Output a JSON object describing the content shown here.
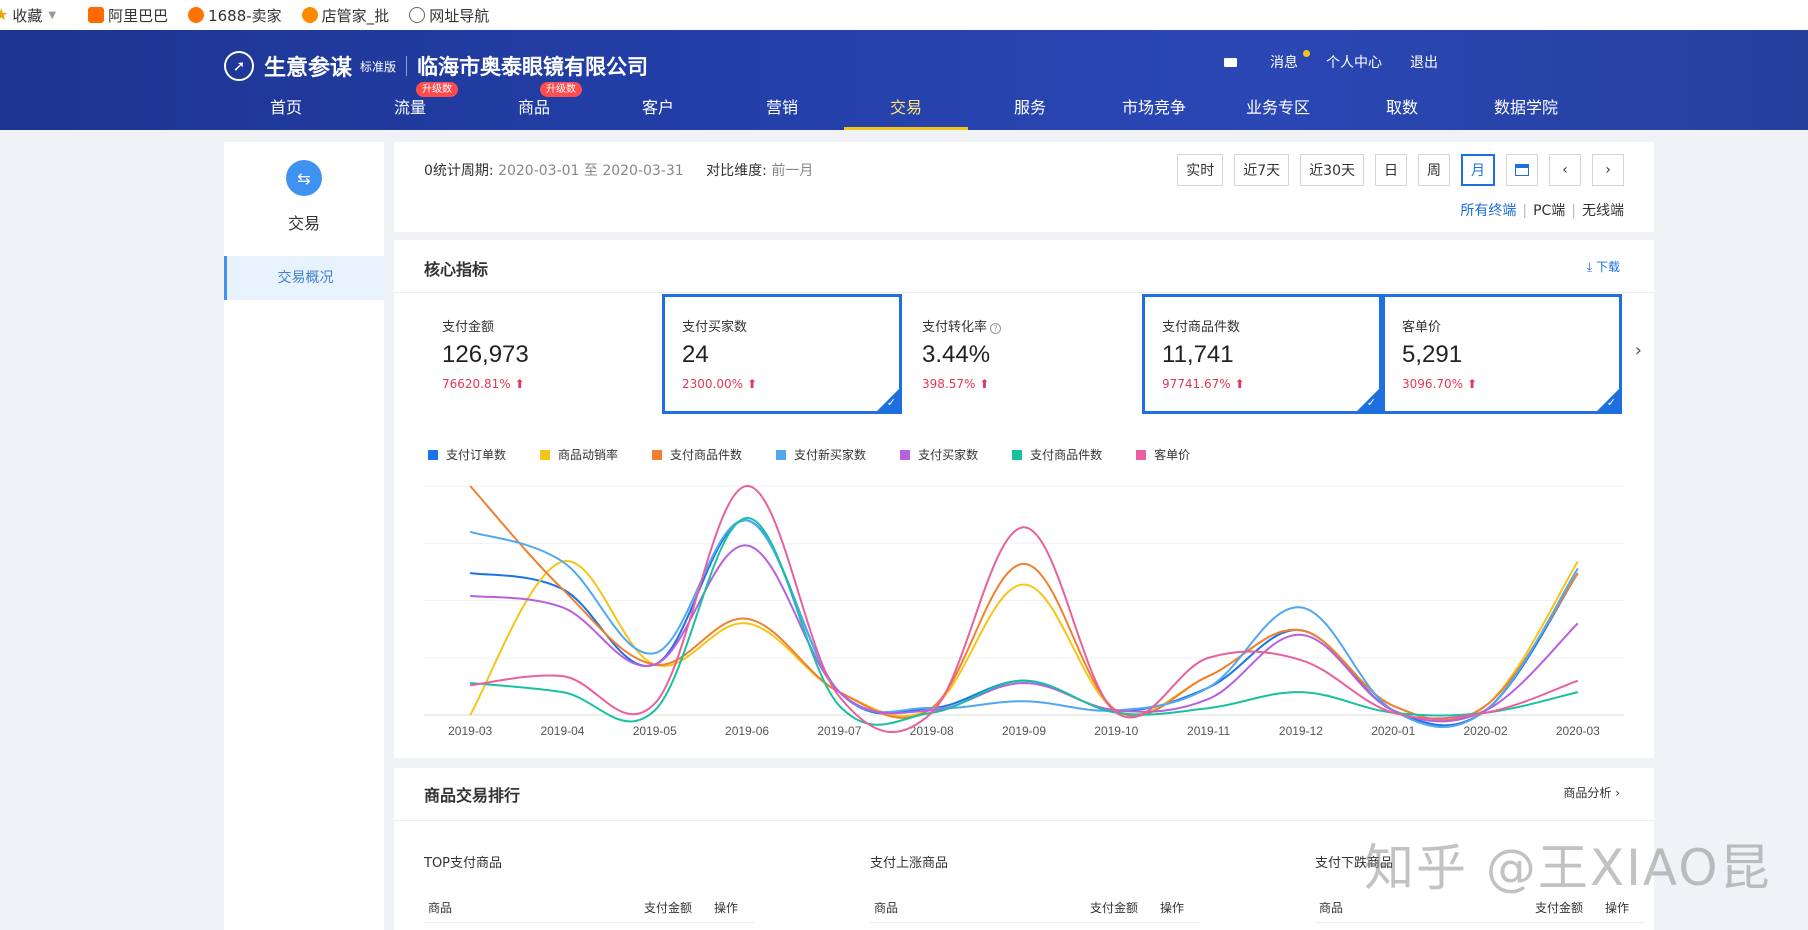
{
  "bookmarks": [
    {
      "label": "收藏",
      "icon": "star-icon"
    },
    {
      "label": "阿里巴巴",
      "icon": "alibaba-icon"
    },
    {
      "label": "1688-卖家",
      "icon": "1688-icon"
    },
    {
      "label": "店管家_批",
      "icon": "dianguanjia-icon"
    },
    {
      "label": "网址导航",
      "icon": "globe-icon"
    }
  ],
  "header": {
    "title": "生意参谋",
    "edition": "标准版",
    "company": "临海市奥泰眼镜有限公司",
    "messages": "消息",
    "personal_center": "个人中心",
    "logout": "退出"
  },
  "nav": [
    {
      "label": "首页",
      "badge": ""
    },
    {
      "label": "流量",
      "badge": "升级数"
    },
    {
      "label": "商品",
      "badge": "升级数"
    },
    {
      "label": "客户",
      "badge": ""
    },
    {
      "label": "营销",
      "badge": ""
    },
    {
      "label": "交易",
      "badge": "",
      "active": true
    },
    {
      "label": "服务",
      "badge": ""
    },
    {
      "label": "市场竞争",
      "badge": ""
    },
    {
      "label": "业务专区",
      "badge": ""
    },
    {
      "label": "取数",
      "badge": ""
    },
    {
      "label": "数据学院",
      "badge": ""
    }
  ],
  "sidebar": {
    "title": "交易",
    "item": "交易概况"
  },
  "period": {
    "label": "0统计周期:",
    "value": "2020-03-01 至 2020-03-31",
    "compare_label": "对比维度:",
    "compare_value": "前一月"
  },
  "time_buttons": [
    "实时",
    "近7天",
    "近30天",
    "日",
    "周",
    "月"
  ],
  "terminals": {
    "all": "所有终端",
    "pc": "PC端",
    "wireless": "无线端"
  },
  "core": {
    "title": "核心指标",
    "download": "下载"
  },
  "kpis": [
    {
      "label": "支付金额",
      "value": "126,973",
      "change": "76620.81%",
      "selected": false
    },
    {
      "label": "支付买家数",
      "value": "24",
      "change": "2300.00%",
      "selected": true
    },
    {
      "label": "支付转化率",
      "value": "3.44%",
      "change": "398.57%",
      "selected": false
    },
    {
      "label": "支付商品件数",
      "value": "11,741",
      "change": "97741.67%",
      "selected": true
    },
    {
      "label": "客单价",
      "value": "5,291",
      "change": "3096.70%",
      "selected": true
    }
  ],
  "chart_data": {
    "type": "line",
    "categories": [
      "2019-03",
      "2019-04",
      "2019-05",
      "2019-06",
      "2019-07",
      "2019-08",
      "2019-09",
      "2019-10",
      "2019-11",
      "2019-12",
      "2020-01",
      "2020-02",
      "2020-03"
    ],
    "series": [
      {
        "name": "支付订单数",
        "color": "#1a73e8",
        "values": [
          62,
          55,
          22,
          85,
          10,
          3,
          15,
          2,
          12,
          37,
          2,
          2,
          62
        ]
      },
      {
        "name": "商品动销率",
        "color": "#f5c518",
        "values": [
          0,
          67,
          22,
          40,
          10,
          3,
          57,
          2,
          17,
          37,
          4,
          4,
          67
        ]
      },
      {
        "name": "支付商品件数",
        "color": "#f08030",
        "values": [
          100,
          55,
          22,
          42,
          10,
          3,
          66,
          2,
          17,
          37,
          4,
          4,
          62
        ]
      },
      {
        "name": "支付新买家数",
        "color": "#52a8f0",
        "values": [
          80,
          67,
          27,
          85,
          10,
          3,
          6,
          2,
          12,
          47,
          2,
          2,
          64
        ]
      },
      {
        "name": "支付买家数",
        "color": "#b760e0",
        "values": [
          52,
          47,
          22,
          74,
          10,
          2,
          14,
          2,
          7,
          35,
          2,
          2,
          40
        ]
      },
      {
        "name": "支付商品件数",
        "color": "#18c1a0",
        "values": [
          14,
          10,
          2,
          86,
          4,
          1,
          15,
          1,
          3,
          10,
          1,
          1,
          10
        ]
      },
      {
        "name": "客单价",
        "color": "#e8609e",
        "values": [
          13,
          17,
          5,
          100,
          8,
          1,
          82,
          1,
          25,
          24,
          1,
          1,
          15
        ]
      }
    ],
    "grid": true,
    "legend": "top-left"
  },
  "rank": {
    "title": "商品交易排行",
    "link": "商品分析",
    "columns": [
      {
        "title": "TOP支付商品",
        "h1": "商品",
        "h2": "支付金额",
        "h3": "操作"
      },
      {
        "title": "支付上涨商品",
        "h1": "商品",
        "h2": "支付金额",
        "h3": "操作"
      },
      {
        "title": "支付下跌商品",
        "h1": "商品",
        "h2": "支付金额",
        "h3": "操作"
      }
    ]
  },
  "watermark": "知乎 @王XIAO昆"
}
